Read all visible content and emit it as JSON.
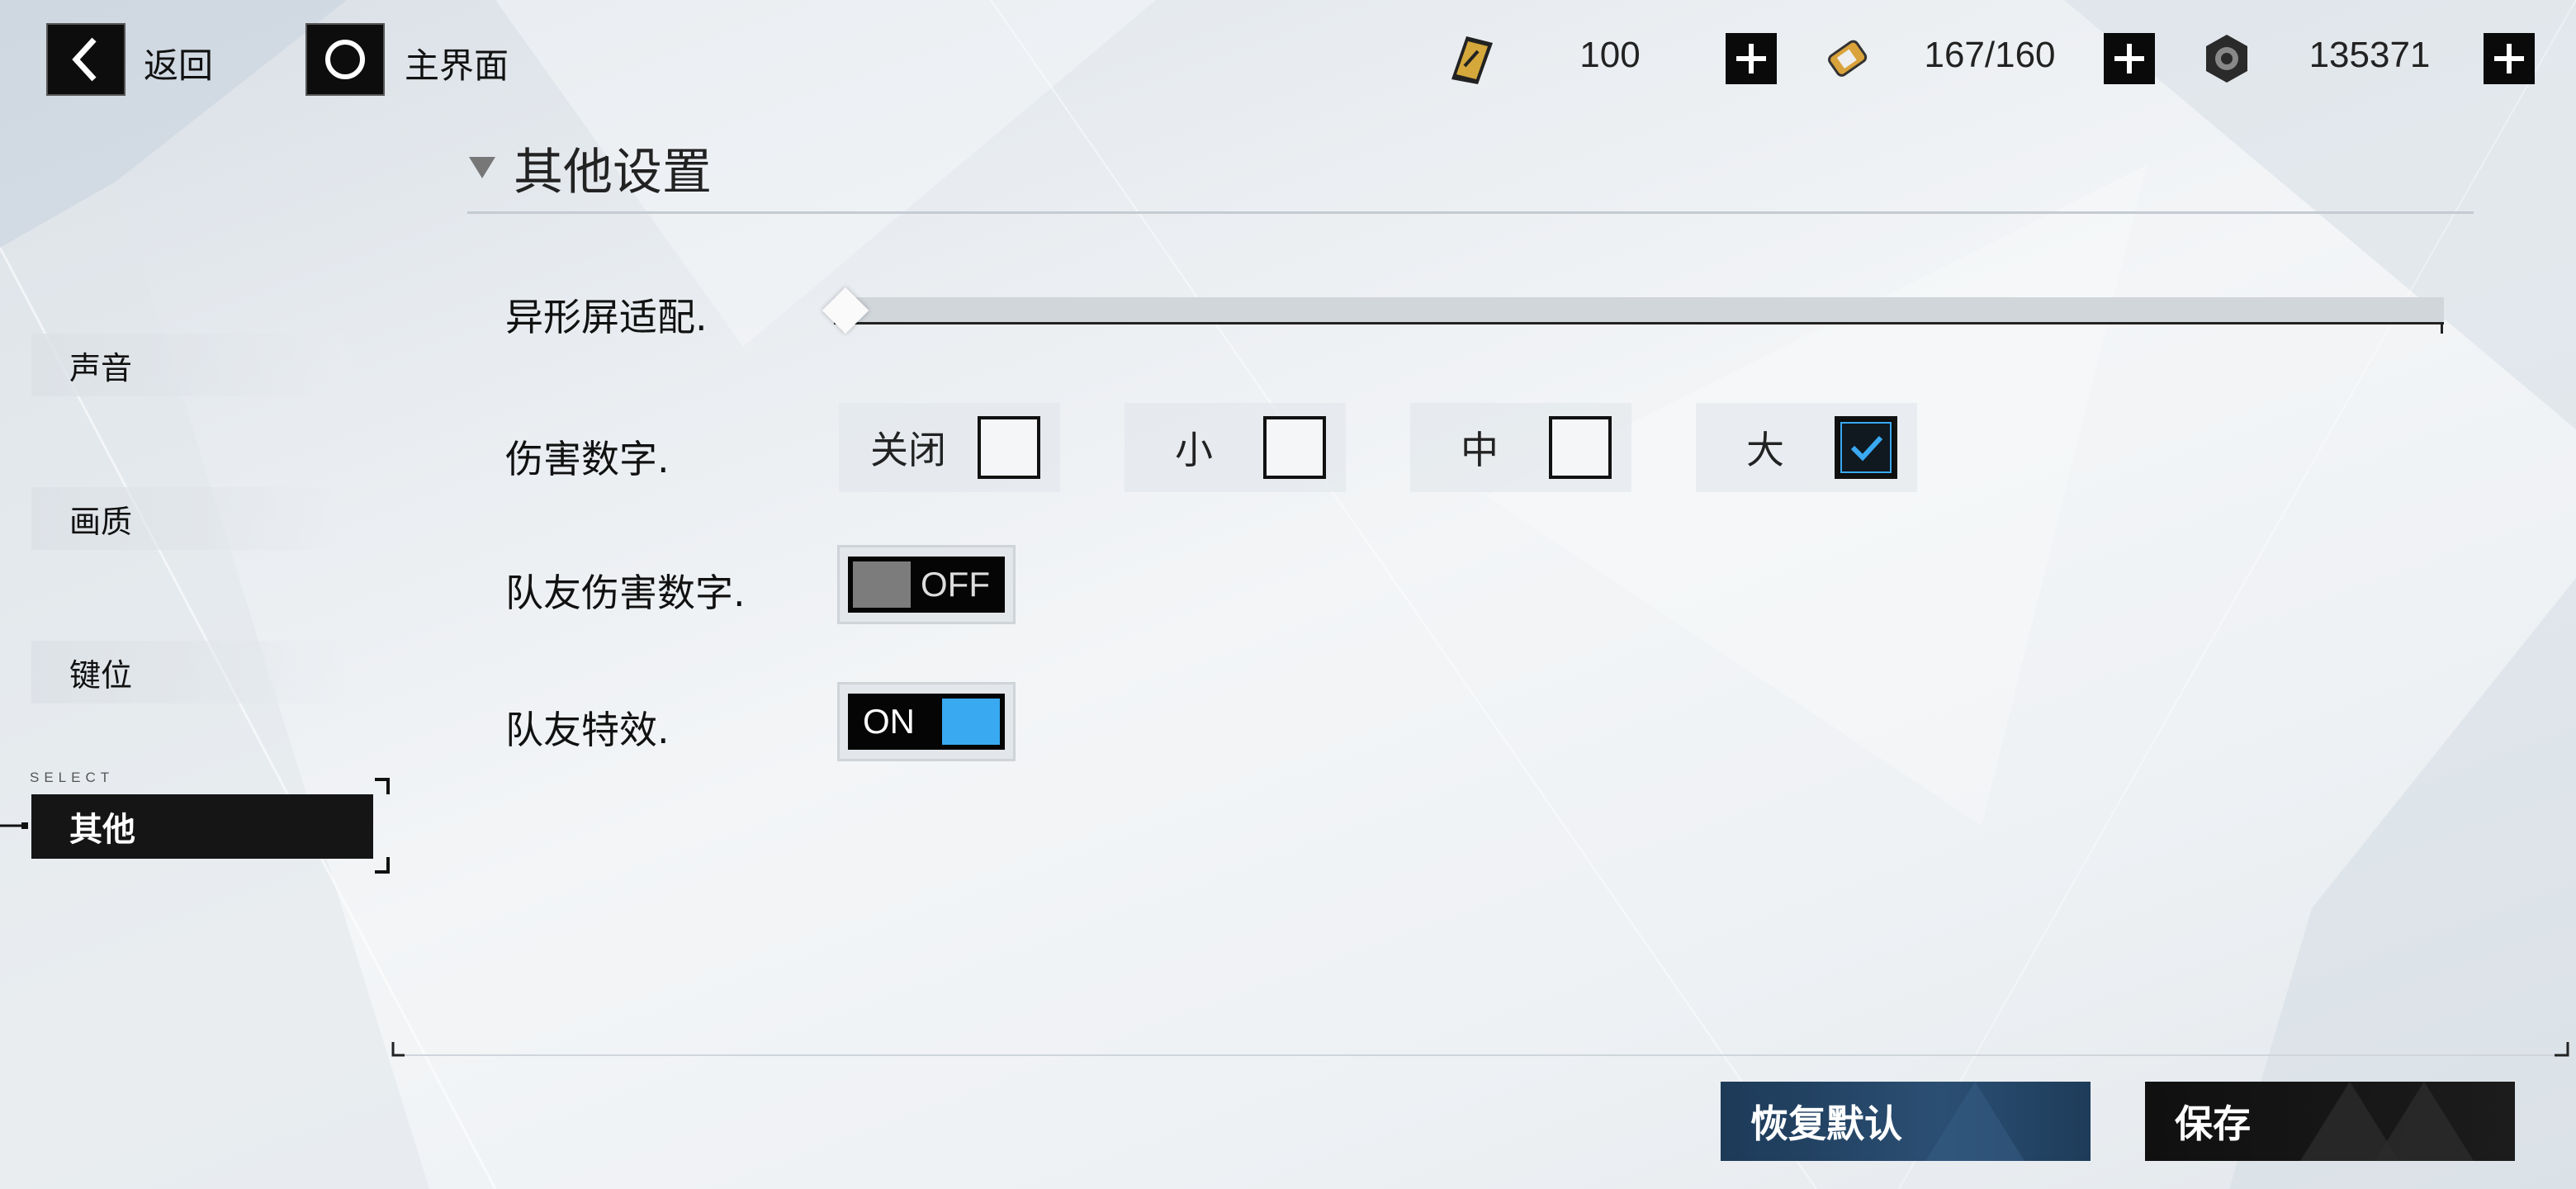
{
  "topbar": {
    "back_label": "返回",
    "home_label": "主界面",
    "resources": [
      {
        "icon": "ticket-icon",
        "value": "100"
      },
      {
        "icon": "battery-icon",
        "value": "167/160"
      },
      {
        "icon": "coin-icon",
        "value": "135371"
      }
    ]
  },
  "sidebar": {
    "items": [
      {
        "label": "声音"
      },
      {
        "label": "画质"
      },
      {
        "label": "键位"
      }
    ],
    "select_caption": "SELECT",
    "active_label": "其他"
  },
  "section": {
    "title": "其他设置",
    "notch_label": "异形屏适配.",
    "notch_slider_value": 0,
    "damage_label": "伤害数字.",
    "damage_options": [
      {
        "label": "关闭",
        "checked": false
      },
      {
        "label": "小",
        "checked": false
      },
      {
        "label": "中",
        "checked": false
      },
      {
        "label": "大",
        "checked": true
      }
    ],
    "teammate_damage_label": "队友伤害数字.",
    "teammate_damage_toggle": "OFF",
    "teammate_fx_label": "队友特效.",
    "teammate_fx_toggle": "ON"
  },
  "footer": {
    "reset_label": "恢复默认",
    "save_label": "保存"
  },
  "colors": {
    "accent_blue": "#39a9f2",
    "toggle_off_gray": "#7c7c7c",
    "reset_button": "#1f3d5c"
  }
}
